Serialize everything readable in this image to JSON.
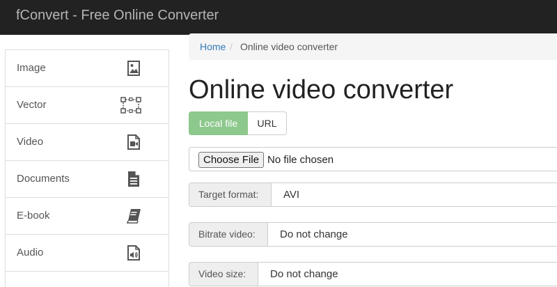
{
  "header": {
    "title": "fConvert - Free Online Converter"
  },
  "sidebar": {
    "items": [
      {
        "label": "Image",
        "icon": "image-icon"
      },
      {
        "label": "Vector",
        "icon": "vector-icon"
      },
      {
        "label": "Video",
        "icon": "video-file-icon"
      },
      {
        "label": "Documents",
        "icon": "document-icon"
      },
      {
        "label": "E-book",
        "icon": "book-icon"
      },
      {
        "label": "Audio",
        "icon": "audio-file-icon"
      }
    ]
  },
  "breadcrumb": {
    "home": "Home",
    "separator": "/",
    "current": "Online video converter"
  },
  "main": {
    "title": "Online video converter",
    "tabs": {
      "local": "Local file",
      "url": "URL"
    },
    "file_input": {
      "button": "Choose File",
      "status": "No file chosen"
    },
    "fields": {
      "target_format": {
        "label": "Target format:",
        "value": "AVI"
      },
      "bitrate_video": {
        "label": "Bitrate video:",
        "value": "Do not change"
      },
      "video_size": {
        "label": "Video size:",
        "value": "Do not change"
      }
    }
  },
  "colors": {
    "navbar": "#222222",
    "brand_text": "#b5b5b5",
    "active_tab": "#8dc88d",
    "link": "#337ab7"
  }
}
